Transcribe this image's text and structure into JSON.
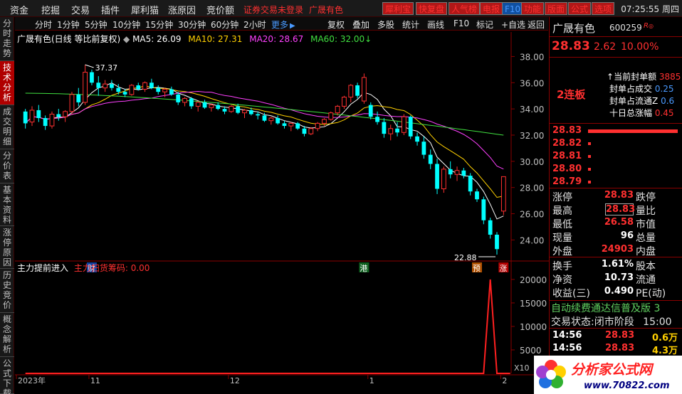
{
  "menubar": {
    "items": [
      "资金",
      "挖掘",
      "交易",
      "插件",
      "犀利猫",
      "涨原因",
      "竞价额"
    ],
    "notice": "证券交易未登录",
    "stock": "广晟有色",
    "buttons": [
      {
        "label": "犀利宝",
        "style": "red"
      },
      {
        "label": "快复盘",
        "style": "red"
      },
      {
        "label": "人气榜",
        "style": "red"
      },
      {
        "label": "电报",
        "style": "red"
      },
      {
        "label": "F10",
        "style": "blue"
      },
      {
        "label": "功能",
        "style": "red"
      },
      {
        "label": "版面",
        "style": "red"
      },
      {
        "label": "公式",
        "style": "red"
      },
      {
        "label": "选项",
        "style": "red"
      }
    ],
    "clock": "07:25:55 周四"
  },
  "lefttabs": [
    "分时走势",
    "技术分析",
    "成交明细",
    "分价表",
    "基本资料",
    "涨停原因",
    "历史竞价",
    "概念解析",
    "公式下载"
  ],
  "toolbar": {
    "periods": [
      "分时",
      "1分钟",
      "5分钟",
      "10分钟",
      "15分钟",
      "30分钟",
      "60分钟",
      "2小时"
    ],
    "more": "更多",
    "actions": [
      "复权",
      "叠加",
      "多股",
      "统计",
      "画线",
      "F10",
      "标记",
      "+自选",
      "返回"
    ]
  },
  "chart_data": [
    {
      "type": "candlestick",
      "title": "广晟有色(日线 等比前复权)",
      "indicators": [
        {
          "name": "MA5",
          "value": "26.09",
          "color": "#ffffff"
        },
        {
          "name": "MA10",
          "value": "27.31",
          "color": "#ffd000"
        },
        {
          "name": "MA20",
          "value": "28.67",
          "color": "#ff40ff"
        },
        {
          "name": "MA60",
          "value": "32.00",
          "color": "#40e040"
        }
      ],
      "ylim": [
        22.5,
        39.0
      ],
      "yticks": [
        "38.00",
        "36.00",
        "34.00",
        "32.00",
        "30.00",
        "28.00",
        "26.00",
        "24.00"
      ],
      "annotations": {
        "high": "37.37",
        "low": "22.88"
      },
      "markers": [
        "财",
        "港",
        "预",
        "涨"
      ],
      "candles": [
        [
          33.8,
          34.0,
          32.5,
          32.9
        ],
        [
          33.0,
          34.2,
          32.7,
          33.9
        ],
        [
          33.9,
          34.3,
          33.0,
          33.3
        ],
        [
          33.3,
          33.5,
          32.4,
          32.7
        ],
        [
          32.7,
          33.8,
          32.5,
          33.6
        ],
        [
          33.6,
          34.0,
          33.1,
          33.4
        ],
        [
          33.4,
          33.9,
          33.0,
          33.8
        ],
        [
          33.8,
          35.3,
          33.6,
          35.1
        ],
        [
          35.1,
          35.6,
          34.2,
          34.5
        ],
        [
          34.5,
          37.37,
          34.3,
          36.8
        ],
        [
          36.8,
          37.0,
          35.8,
          36.0
        ],
        [
          36.0,
          36.5,
          35.0,
          35.6
        ],
        [
          35.6,
          36.2,
          35.3,
          35.9
        ],
        [
          35.9,
          36.2,
          35.4,
          35.6
        ],
        [
          35.6,
          35.9,
          35.1,
          35.3
        ],
        [
          35.3,
          35.5,
          34.9,
          35.1
        ],
        [
          35.1,
          35.9,
          35.0,
          35.8
        ],
        [
          35.8,
          36.0,
          35.4,
          35.5
        ],
        [
          35.5,
          36.1,
          35.3,
          36.0
        ],
        [
          36.0,
          36.3,
          35.5,
          35.6
        ],
        [
          35.6,
          35.8,
          35.1,
          35.3
        ],
        [
          35.3,
          35.6,
          34.9,
          35.5
        ],
        [
          35.5,
          35.7,
          35.0,
          35.1
        ],
        [
          35.1,
          35.3,
          34.3,
          34.5
        ],
        [
          34.5,
          34.9,
          34.2,
          34.8
        ],
        [
          34.8,
          34.9,
          34.0,
          34.2
        ],
        [
          34.2,
          34.6,
          33.8,
          34.5
        ],
        [
          34.5,
          34.7,
          34.0,
          34.1
        ],
        [
          34.1,
          34.4,
          33.8,
          34.3
        ],
        [
          34.3,
          34.5,
          33.9,
          34.0
        ],
        [
          34.0,
          34.2,
          33.6,
          33.8
        ],
        [
          33.8,
          34.3,
          33.7,
          34.2
        ],
        [
          34.2,
          34.4,
          33.6,
          33.7
        ],
        [
          33.7,
          34.0,
          33.3,
          33.9
        ],
        [
          33.9,
          34.1,
          33.5,
          33.6
        ],
        [
          33.6,
          33.8,
          33.2,
          33.5
        ],
        [
          33.5,
          33.7,
          33.0,
          33.1
        ],
        [
          33.1,
          33.4,
          32.8,
          33.3
        ],
        [
          33.3,
          33.5,
          32.8,
          32.9
        ],
        [
          32.9,
          33.1,
          32.5,
          32.7
        ],
        [
          32.7,
          33.0,
          32.3,
          32.9
        ],
        [
          32.9,
          33.0,
          32.4,
          32.5
        ],
        [
          32.5,
          32.7,
          31.9,
          32.1
        ],
        [
          32.1,
          32.6,
          32.0,
          32.5
        ],
        [
          32.5,
          33.0,
          32.3,
          32.9
        ],
        [
          32.9,
          33.3,
          32.7,
          33.2
        ],
        [
          33.2,
          33.8,
          33.1,
          33.7
        ],
        [
          33.7,
          34.3,
          33.5,
          34.2
        ],
        [
          34.2,
          35.0,
          34.0,
          34.9
        ],
        [
          34.9,
          35.9,
          34.5,
          35.8
        ],
        [
          35.8,
          36.0,
          34.8,
          35.0
        ],
        [
          34.6,
          36.7,
          34.4,
          36.4
        ],
        [
          34.3,
          34.5,
          33.2,
          33.4
        ],
        [
          33.4,
          33.8,
          32.8,
          33.0
        ],
        [
          33.0,
          33.3,
          31.8,
          32.1
        ],
        [
          32.1,
          32.8,
          31.6,
          32.5
        ],
        [
          32.5,
          33.0,
          31.9,
          32.2
        ],
        [
          32.2,
          33.6,
          32.0,
          33.4
        ],
        [
          33.4,
          33.5,
          31.7,
          31.9
        ],
        [
          31.9,
          32.2,
          31.2,
          31.5
        ],
        [
          31.5,
          31.9,
          30.2,
          30.5
        ],
        [
          30.5,
          30.9,
          29.4,
          29.8
        ],
        [
          29.8,
          30.2,
          27.5,
          27.9
        ],
        [
          27.9,
          29.6,
          27.6,
          29.4
        ],
        [
          29.4,
          30.0,
          28.7,
          29.0
        ],
        [
          29.0,
          29.6,
          28.5,
          29.3
        ],
        [
          29.3,
          29.5,
          28.7,
          28.9
        ],
        [
          28.9,
          29.1,
          27.4,
          27.7
        ],
        [
          27.7,
          27.9,
          26.9,
          27.1
        ],
        [
          27.1,
          27.3,
          25.2,
          25.5
        ],
        [
          25.5,
          25.7,
          24.1,
          24.4
        ],
        [
          24.4,
          24.6,
          22.88,
          23.3
        ],
        [
          26.2,
          28.83,
          25.9,
          28.83
        ]
      ]
    },
    {
      "type": "line",
      "title": "主力提前进入",
      "series": [
        {
          "name": "主力扫货筹码",
          "value": "0.00",
          "color": "#ff2020"
        }
      ],
      "ylim": [
        0,
        21500
      ],
      "yticks": [
        "20000",
        "15000",
        "10000",
        "5000"
      ],
      "unit": "X10",
      "values": [
        0,
        0,
        0,
        0,
        0,
        0,
        0,
        0,
        0,
        0,
        0,
        0,
        0,
        0,
        0,
        0,
        0,
        0,
        0,
        0,
        0,
        0,
        0,
        0,
        0,
        0,
        0,
        0,
        0,
        0,
        0,
        0,
        0,
        0,
        0,
        0,
        0,
        0,
        0,
        0,
        0,
        0,
        0,
        0,
        0,
        0,
        0,
        0,
        0,
        0,
        0,
        0,
        0,
        0,
        0,
        0,
        0,
        0,
        0,
        0,
        0,
        0,
        0,
        0,
        0,
        0,
        0,
        0,
        0,
        0,
        20000,
        0,
        0,
        0
      ]
    }
  ],
  "xaxis_labels": [
    "2023年",
    "11",
    "12",
    "1",
    "2"
  ],
  "quote": {
    "name": "广晟有色",
    "code": "600259",
    "tag": "R",
    "price": "28.83",
    "change": "2.62",
    "pct": "10.00%",
    "streak": "2连板",
    "seal_rows": [
      {
        "label": "当前封单额",
        "value": "3885"
      },
      {
        "label": "封单占成交",
        "value": "0.25"
      },
      {
        "label": "封单占流通Z",
        "value": "0.6"
      },
      {
        "label": "十日总涨幅",
        "value": "0.45"
      }
    ],
    "orderbook": [
      {
        "price": "28.83",
        "bar": 1.0
      },
      {
        "price": "28.82",
        "bar": 0.02
      },
      {
        "price": "28.81",
        "bar": 0.02
      },
      {
        "price": "28.80",
        "bar": 0.02
      },
      {
        "price": "28.79",
        "bar": 0.02
      }
    ],
    "stats": [
      {
        "k1": "涨停",
        "v1": "28.83",
        "k2": "跌停"
      },
      {
        "k1": "最高",
        "v1": "28.83",
        "k2": "量比"
      },
      {
        "k1": "最低",
        "v1": "26.58",
        "k2": "市值"
      },
      {
        "k1": "现量",
        "v1": "96",
        "k2": "总量"
      },
      {
        "k1": "外盘",
        "v1": "24903",
        "k2": "内盘"
      }
    ],
    "stats2": [
      {
        "k1": "换手",
        "v1": "1.61%",
        "k2": "股本"
      },
      {
        "k1": "净资",
        "v1": "10.73",
        "k2": "流通"
      },
      {
        "k1": "收益(三)",
        "v1": "0.490",
        "k2": "PE(动)"
      }
    ],
    "banner": "自动续费通达信普及版 3",
    "status_label": "交易状态:",
    "status_value": "闭市阶段",
    "status_time": "15:00",
    "ticks": [
      {
        "time": "14:56",
        "price": "28.83",
        "vol": "0.6万"
      },
      {
        "time": "14:56",
        "price": "28.83",
        "vol": "4.3万"
      }
    ]
  },
  "logo": {
    "text": "分析家公式网",
    "url": "www.70822.com"
  }
}
